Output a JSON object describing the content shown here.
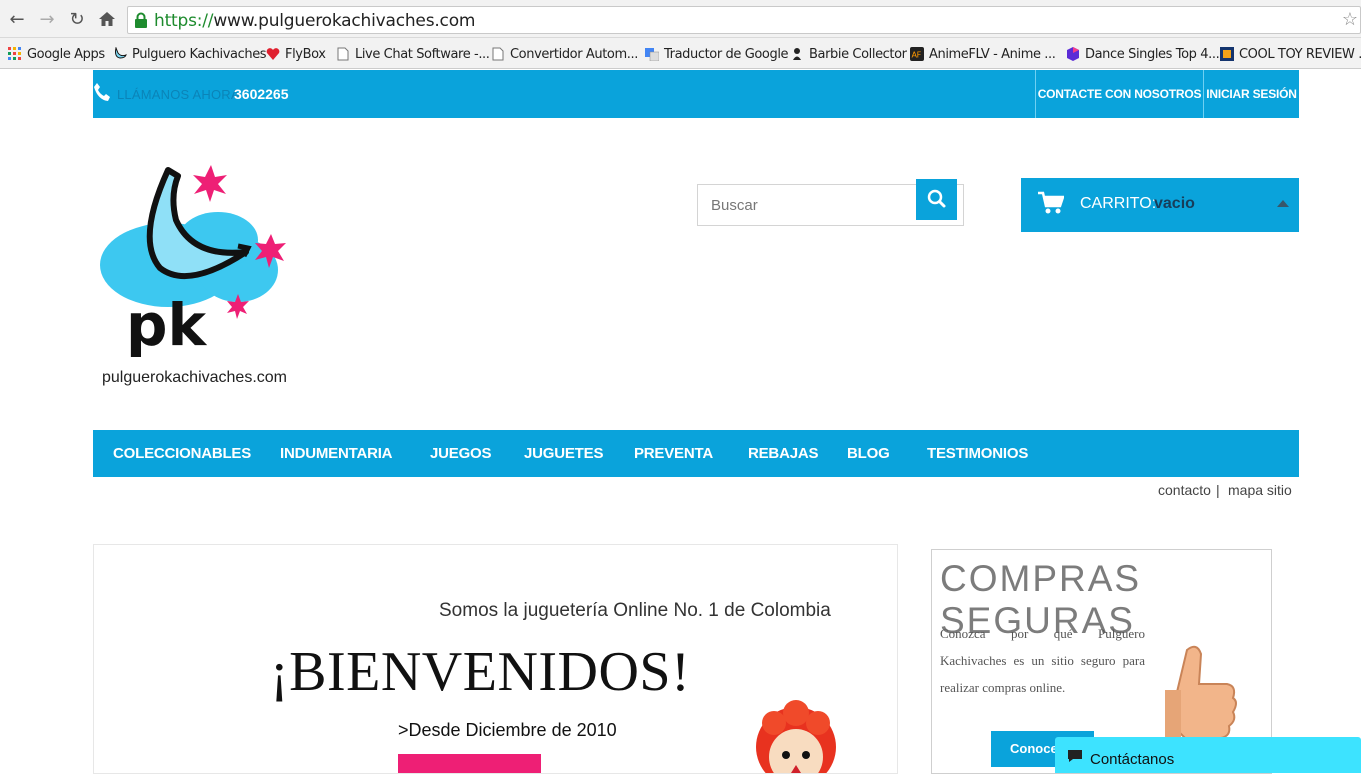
{
  "browser": {
    "url_scheme": "https://",
    "url_rest": "www.pulguerokachivaches.com",
    "bookmarks": [
      {
        "label": "Google Apps",
        "icon": "apps-grid-icon"
      },
      {
        "label": "Pulguero Kachivaches",
        "icon": "site-favicon"
      },
      {
        "label": "FlyBox",
        "icon": "heart-icon"
      },
      {
        "label": "Live Chat Software -...",
        "icon": "page-icon"
      },
      {
        "label": "Convertidor Autom...",
        "icon": "page-icon"
      },
      {
        "label": "Traductor de Google",
        "icon": "translate-icon"
      },
      {
        "label": "Barbie Collector",
        "icon": "barbie-icon"
      },
      {
        "label": "AnimeFLV - Anime ...",
        "icon": "anime-icon"
      },
      {
        "label": "Dance Singles Top 4...",
        "icon": "dance-icon"
      },
      {
        "label": "COOL TOY REVIEW ...",
        "icon": "video-icon"
      }
    ]
  },
  "topbar": {
    "call_label": "LLÁMANOS AHORA",
    "call_number": "3602265",
    "links": [
      "CONTACTE CON NOSOTROS",
      "INICIAR SESIÓN"
    ]
  },
  "logo": {
    "monogram": "pk",
    "text": "pulguerokachivaches.com"
  },
  "search": {
    "placeholder": "Buscar"
  },
  "cart": {
    "label": "CARRITO:",
    "value": "vacio"
  },
  "mainnav": {
    "items": [
      "COLECCIONABLES",
      "INDUMENTARIA",
      "JUEGOS",
      "JUGUETES",
      "PREVENTA",
      "REBAJAS",
      "BLOG",
      "TESTIMONIOS"
    ]
  },
  "util": {
    "contact": "contacto",
    "separator": "|",
    "sitemap": "mapa sitio"
  },
  "banner": {
    "tagline": "Somos la juguetería Online No. 1 de Colombia",
    "welcome": "¡BIENVENIDOS!",
    "since": ">Desde Diciembre de 2010"
  },
  "secure": {
    "title": "COMPRAS SEGURAS",
    "text": "Conozca por qué Pulguero Kachivaches es un sitio seguro para realizar compras online.",
    "button": "Conoce m"
  },
  "chat": {
    "label": "Contáctanos"
  },
  "colors": {
    "brand_blue": "#0aa3db",
    "pink": "#ee1f75",
    "chat_cyan": "#3de3ff"
  }
}
